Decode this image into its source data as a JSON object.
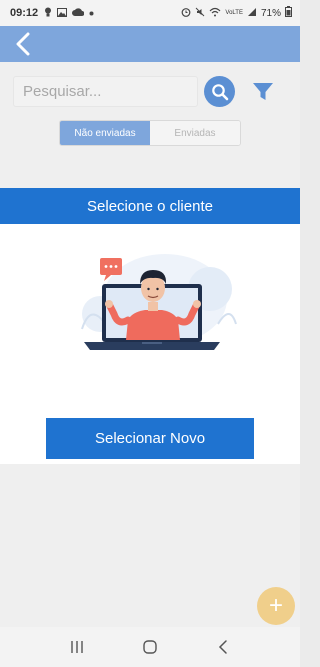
{
  "status_bar": {
    "time": "09:12",
    "battery": "71%",
    "network_label": "VoLTE",
    "icons": [
      "bulb-icon",
      "image-icon",
      "cloud-icon",
      "dot-icon",
      "alarm-icon",
      "mute-icon",
      "wifi-icon",
      "signal-icon",
      "battery-icon"
    ]
  },
  "header": {
    "back_icon": "chevron-left-icon",
    "background_color": "#7ea6dc"
  },
  "search": {
    "placeholder": "Pesquisar...",
    "value": "",
    "search_icon": "search-icon",
    "filter_icon": "filter-icon"
  },
  "tabs": [
    {
      "label": "Não enviadas",
      "active": true
    },
    {
      "label": "Enviadas",
      "active": false
    }
  ],
  "section_title": "Selecione o cliente",
  "primary_button": "Selecionar Novo",
  "fab_label": "+",
  "colors": {
    "primary": "#1f73d0",
    "header": "#7ea6dc",
    "fab": "#f0cf8b"
  },
  "system_nav": [
    "recent-apps-icon",
    "home-icon",
    "back-icon"
  ]
}
